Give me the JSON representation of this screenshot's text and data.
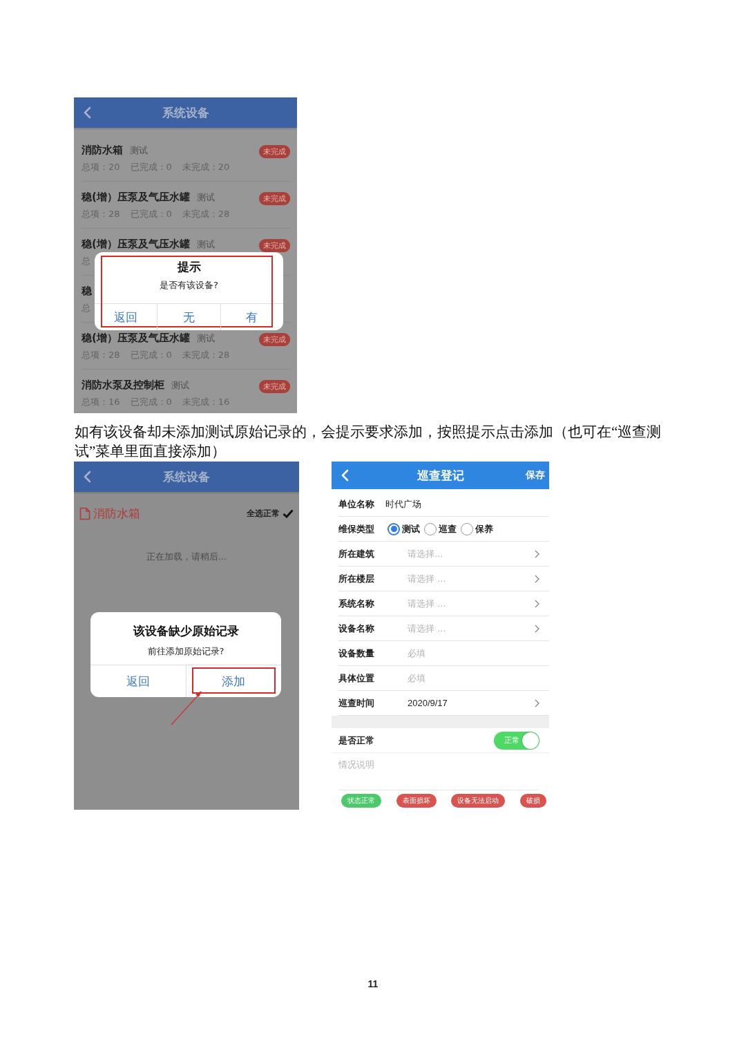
{
  "screen_1": {
    "header": {
      "title": "系统设备"
    },
    "rows": [
      {
        "title": "消防水箱",
        "tag": "测试",
        "badge": "未完成",
        "stats": [
          "总项：20",
          "已完成：0",
          "未完成：20"
        ]
      },
      {
        "title": "稳(增）压泵及气压水罐",
        "tag": "测试",
        "badge": "未完成",
        "stats": [
          "总项：28",
          "已完成：0",
          "未完成：28"
        ]
      },
      {
        "title": "稳(增）压泵及气压水罐",
        "tag": "测试",
        "badge": "未完成",
        "stats": [
          "总"
        ]
      },
      {
        "title": "稳",
        "stats": [
          "总"
        ]
      },
      {
        "title": "稳(增）压泵及气压水罐",
        "tag": "测试",
        "badge": "未完成",
        "stats": [
          "总项：28",
          "已完成：0",
          "未完成：28"
        ]
      },
      {
        "title": "消防水泵及控制柜",
        "tag": "测试",
        "badge": "未完成",
        "stats": [
          "总项：16",
          "已完成：0",
          "未完成：16"
        ]
      }
    ],
    "dialog": {
      "title": "提示",
      "message": "是否有该设备?",
      "highlighted": true,
      "buttons": [
        {
          "label": "返回",
          "highlighted": false
        },
        {
          "label": "无",
          "highlighted": false
        },
        {
          "label": "有",
          "highlighted": false
        }
      ]
    }
  },
  "caption": "如有该设备却未添加测试原始记录的，会提示要求添加，按照提示点击添加（也可在“巡查测试”菜单里面直接添加）",
  "screen_2": {
    "header": {
      "title": "系统设备"
    },
    "section": {
      "title": "消防水箱",
      "action": "全选正常"
    },
    "loading": "正在加载，请稍后...",
    "dialog": {
      "title": "该设备缺少原始记录",
      "message": "前往添加原始记录?",
      "highlighted": false,
      "buttons": [
        {
          "label": "返回",
          "highlighted": false
        },
        {
          "label": "添加",
          "highlighted": true
        }
      ]
    }
  },
  "screen_3": {
    "header": {
      "title": "巡查登记",
      "action": "保存"
    },
    "fields": [
      {
        "kind": "text",
        "label": "单位名称",
        "value": "时代广场"
      },
      {
        "kind": "radio",
        "label": "维保类型",
        "options": [
          {
            "label": "测试",
            "selected": true
          },
          {
            "label": "巡查",
            "selected": false
          },
          {
            "label": "保养",
            "selected": false
          }
        ]
      },
      {
        "kind": "select",
        "label": "所在建筑",
        "placeholder": "请选择..."
      },
      {
        "kind": "select",
        "label": "所在楼层",
        "placeholder": "请选择 ..."
      },
      {
        "kind": "select",
        "label": "系统名称",
        "placeholder": "请选择 ..."
      },
      {
        "kind": "select",
        "label": "设备名称",
        "placeholder": "请选择 ..."
      },
      {
        "kind": "input",
        "label": "设备数量",
        "placeholder": "必填"
      },
      {
        "kind": "input",
        "label": "具体位置",
        "placeholder": "必填"
      },
      {
        "kind": "select",
        "label": "巡查时间",
        "value": "2020/9/17"
      }
    ],
    "normal": {
      "label": "是否正常",
      "toggle_label": "正常",
      "on": true
    },
    "notes": {
      "placeholder": "情况说明"
    },
    "tags": [
      {
        "label": "状态正常",
        "color": "#4cc96a"
      },
      {
        "label": "表面损坏",
        "color": "#d9534f"
      },
      {
        "label": "设备无法启动",
        "color": "#d9534f"
      },
      {
        "label": "破损",
        "color": "#d9534f"
      }
    ]
  },
  "page_number": "11"
}
